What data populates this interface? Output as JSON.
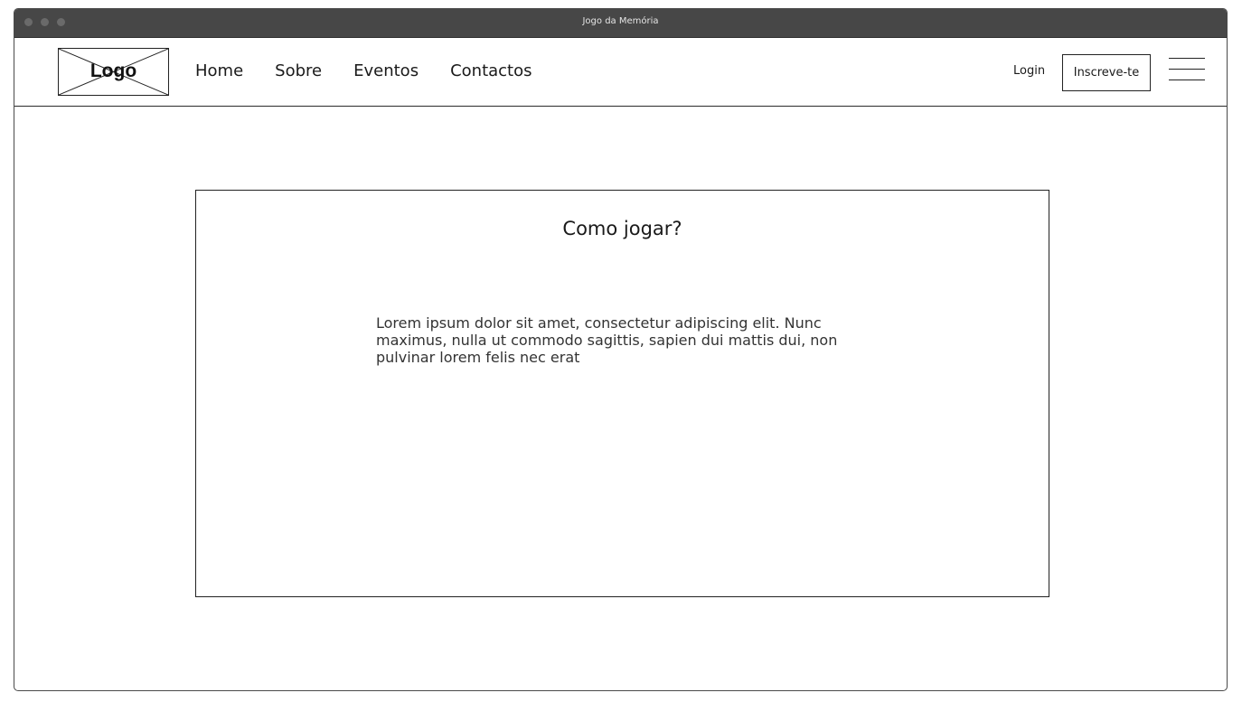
{
  "window": {
    "title": "Jogo da Memória"
  },
  "navbar": {
    "logo": "Logo",
    "links": [
      "Home",
      "Sobre",
      "Eventos",
      "Contactos"
    ],
    "login": "Login",
    "signup": "Inscreve-te"
  },
  "main": {
    "title": "Como jogar?",
    "body": "Lorem ipsum dolor sit amet, consectetur adipiscing elit. Nunc maximus, nulla ut commodo sagittis, sapien dui mattis dui, non pulvinar lorem felis nec erat"
  },
  "colors": {
    "titlebar": "#474747",
    "border": "#222222"
  }
}
